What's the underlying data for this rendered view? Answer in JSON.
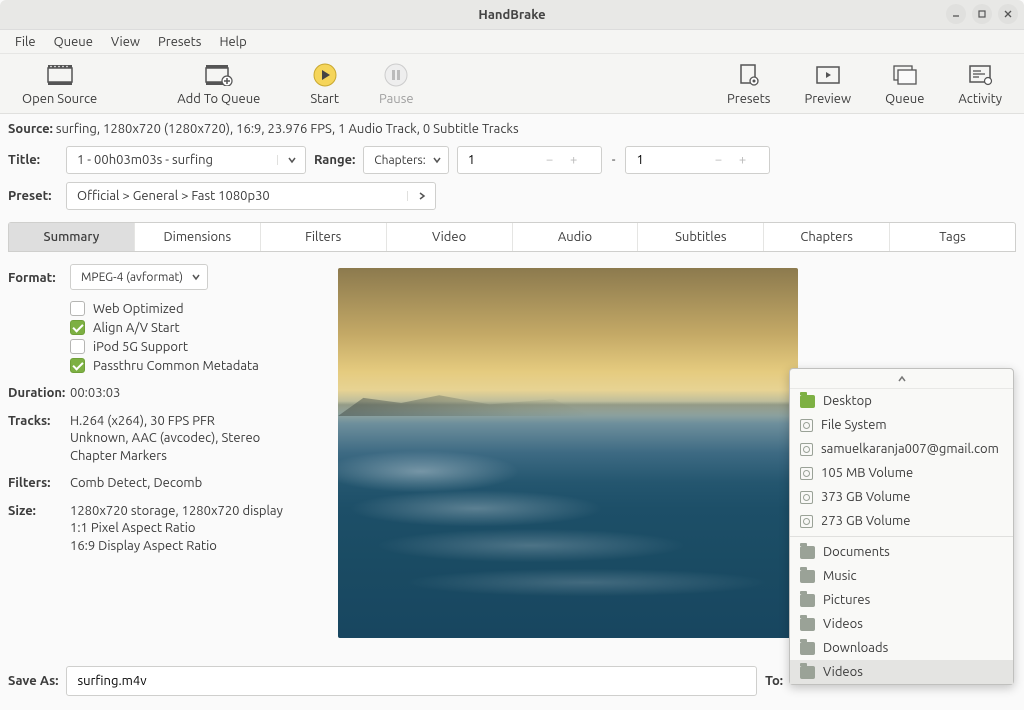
{
  "window": {
    "title": "HandBrake"
  },
  "menubar": [
    "File",
    "Queue",
    "View",
    "Presets",
    "Help"
  ],
  "toolbar": {
    "open_source": "Open Source",
    "add_to_queue": "Add To Queue",
    "start": "Start",
    "pause": "Pause",
    "presets": "Presets",
    "preview": "Preview",
    "queue": "Queue",
    "activity": "Activity"
  },
  "source": {
    "label": "Source:",
    "value": "surfing, 1280x720 (1280x720), 16:9, 23.976 FPS, 1 Audio Track, 0 Subtitle Tracks"
  },
  "title": {
    "label": "Title:",
    "value": "1 - 00h03m03s - surfing"
  },
  "range": {
    "label": "Range:",
    "type": "Chapters:",
    "from": "1",
    "to": "1"
  },
  "preset": {
    "label": "Preset:",
    "value": "Official > General > Fast 1080p30"
  },
  "tabs": [
    "Summary",
    "Dimensions",
    "Filters",
    "Video",
    "Audio",
    "Subtitles",
    "Chapters",
    "Tags"
  ],
  "summary": {
    "format_label": "Format:",
    "format_value": "MPEG-4 (avformat)",
    "checks": {
      "web_optimized": {
        "label": "Web Optimized",
        "checked": false
      },
      "align_av": {
        "label": "Align A/V Start",
        "checked": true
      },
      "ipod": {
        "label": "iPod 5G Support",
        "checked": false
      },
      "passthru": {
        "label": "Passthru Common Metadata",
        "checked": true
      }
    },
    "duration_label": "Duration:",
    "duration_value": "00:03:03",
    "tracks_label": "Tracks:",
    "tracks_value": "H.264 (x264), 30 FPS PFR\nUnknown, AAC (avcodec), Stereo\nChapter Markers",
    "filters_label": "Filters:",
    "filters_value": "Comb Detect, Decomb",
    "size_label": "Size:",
    "size_value": "1280x720 storage, 1280x720 display\n1:1 Pixel Aspect Ratio\n16:9 Display Aspect Ratio"
  },
  "save": {
    "label": "Save As:",
    "value": "surfing.m4v",
    "to_label": "To:"
  },
  "popup": {
    "items": [
      {
        "icon": "folder-green",
        "label": "Desktop"
      },
      {
        "icon": "disk",
        "label": "File System"
      },
      {
        "icon": "disk",
        "label": "samuelkaranja007@gmail.com"
      },
      {
        "icon": "disk",
        "label": "105 MB Volume"
      },
      {
        "icon": "disk",
        "label": "373 GB Volume"
      },
      {
        "icon": "disk",
        "label": "273 GB Volume"
      },
      {
        "sep": true
      },
      {
        "icon": "folder",
        "label": "Documents"
      },
      {
        "icon": "folder",
        "label": "Music"
      },
      {
        "icon": "folder",
        "label": "Pictures"
      },
      {
        "icon": "folder",
        "label": "Videos"
      },
      {
        "icon": "folder",
        "label": "Downloads"
      },
      {
        "icon": "folder",
        "label": "Videos",
        "selected": true
      }
    ]
  }
}
